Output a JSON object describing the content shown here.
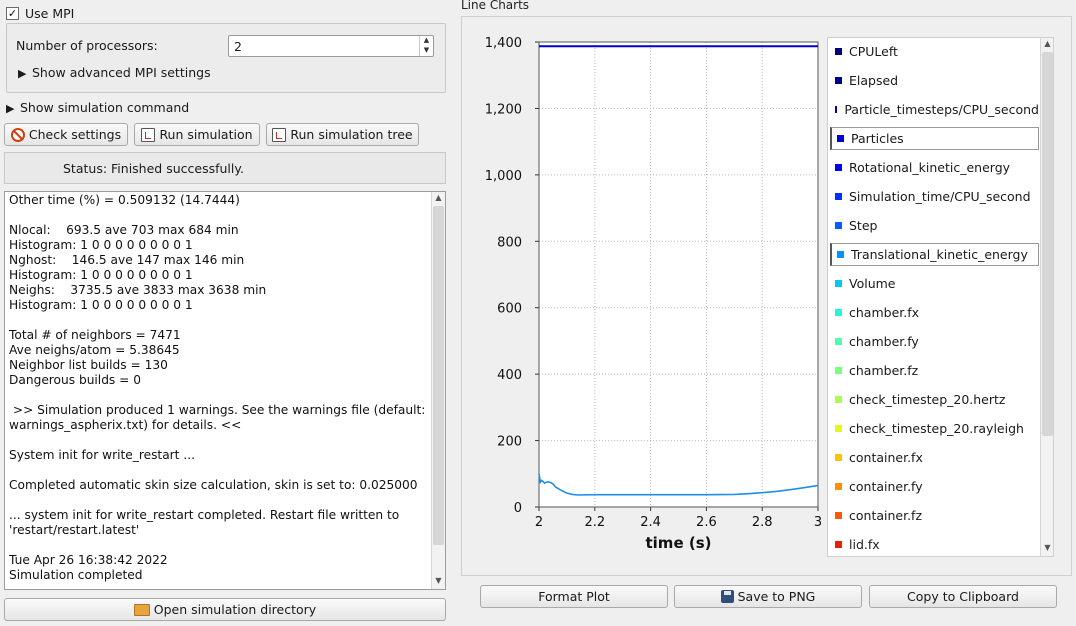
{
  "mpi": {
    "use_label": "Use MPI",
    "use_checked_mark": "✓",
    "processors_label": "Number of processors:",
    "processors_value": "2",
    "advanced_label": "Show advanced MPI settings"
  },
  "sim": {
    "show_command_label": "Show simulation command",
    "check_label": "Check settings",
    "run_label": "Run simulation",
    "run_tree_label": "Run simulation tree",
    "status": "Status: Finished successfully.",
    "open_dir_label": "Open simulation directory"
  },
  "log": {
    "lines": [
      "Other time (%) = 0.509132 (14.7444)",
      "",
      "Nlocal:    693.5 ave 703 max 684 min",
      "Histogram: 1 0 0 0 0 0 0 0 0 1",
      "Nghost:    146.5 ave 147 max 146 min",
      "Histogram: 1 0 0 0 0 0 0 0 0 1",
      "Neighs:    3735.5 ave 3833 max 3638 min",
      "Histogram: 1 0 0 0 0 0 0 0 0 1",
      "",
      "Total # of neighbors = 7471",
      "Ave neighs/atom = 5.38645",
      "Neighbor list builds = 130",
      "Dangerous builds = 0",
      "",
      " >> Simulation produced 1 warnings. See the warnings file (default:",
      "warnings_aspherix.txt) for details. <<",
      "",
      "System init for write_restart ...",
      "",
      "Completed automatic skin size calculation, skin is set to: 0.025000",
      "",
      "... system init for write_restart completed. Restart file written to",
      "'restart/restart.latest'",
      "",
      "Tue Apr 26 16:38:42 2022",
      "Simulation completed"
    ]
  },
  "charts": {
    "title": "Line Charts",
    "format_label": "Format Plot",
    "save_label": "Save to PNG",
    "copy_label": "Copy to Clipboard",
    "legend": [
      {
        "label": "CPULeft",
        "color": "#00007f",
        "selected": false
      },
      {
        "label": "Elapsed",
        "color": "#00008f",
        "selected": false
      },
      {
        "label": "Particle_timesteps/CPU_second",
        "color": "#0000b0",
        "selected": false
      },
      {
        "label": "Particles",
        "color": "#0000d5",
        "selected": true
      },
      {
        "label": "Rotational_kinetic_energy",
        "color": "#0000f5",
        "selected": false
      },
      {
        "label": "Simulation_time/CPU_second",
        "color": "#0030ff",
        "selected": false
      },
      {
        "label": "Step",
        "color": "#0060ff",
        "selected": false
      },
      {
        "label": "Translational_kinetic_energy",
        "color": "#0094ff",
        "selected": true
      },
      {
        "label": "Volume",
        "color": "#00c8f5",
        "selected": false
      },
      {
        "label": "chamber.fx",
        "color": "#26f5d2",
        "selected": false
      },
      {
        "label": "chamber.fy",
        "color": "#4dffaa",
        "selected": false
      },
      {
        "label": "chamber.fz",
        "color": "#7bff7b",
        "selected": false
      },
      {
        "label": "check_timestep_20.hertz",
        "color": "#aaff4d",
        "selected": false
      },
      {
        "label": "check_timestep_20.rayleigh",
        "color": "#e6f51a",
        "selected": false
      },
      {
        "label": "container.fx",
        "color": "#ffc400",
        "selected": false
      },
      {
        "label": "container.fy",
        "color": "#ff9000",
        "selected": false
      },
      {
        "label": "container.fz",
        "color": "#ff5a00",
        "selected": false
      },
      {
        "label": "lid.fx",
        "color": "#e82000",
        "selected": false
      }
    ]
  },
  "chart_data": {
    "type": "line",
    "xlabel": "time (s)",
    "ylabel": "",
    "xlim": [
      2,
      3
    ],
    "ylim": [
      0,
      1400
    ],
    "x_ticks": [
      2,
      2.2,
      2.4,
      2.6,
      2.8,
      3
    ],
    "x_tick_labels": [
      "2",
      "2.2",
      "2.4",
      "2.6",
      "2.8",
      "3"
    ],
    "y_ticks": [
      0,
      200,
      400,
      600,
      800,
      1000,
      1200,
      1400
    ],
    "y_tick_labels": [
      "0",
      "200",
      "400",
      "600",
      "800",
      "1,000",
      "1,200",
      "1,400"
    ],
    "grid": true,
    "series": [
      {
        "name": "Particles",
        "color": "#0000d5",
        "x": [
          2.0,
          3.0
        ],
        "y": [
          1387,
          1387
        ]
      },
      {
        "name": "Translational_kinetic_energy",
        "color": "#1e90e8",
        "x": [
          2.0,
          2.005,
          2.01,
          2.02,
          2.03,
          2.04,
          2.05,
          2.06,
          2.08,
          2.1,
          2.12,
          2.14,
          2.2,
          2.3,
          2.4,
          2.5,
          2.6,
          2.7,
          2.75,
          2.8,
          2.85,
          2.9,
          2.95,
          3.0
        ],
        "y": [
          100,
          75,
          80,
          72,
          76,
          74,
          70,
          60,
          50,
          42,
          38,
          36,
          37,
          37,
          37,
          37,
          37,
          38,
          40,
          43,
          47,
          52,
          58,
          65
        ]
      }
    ]
  }
}
